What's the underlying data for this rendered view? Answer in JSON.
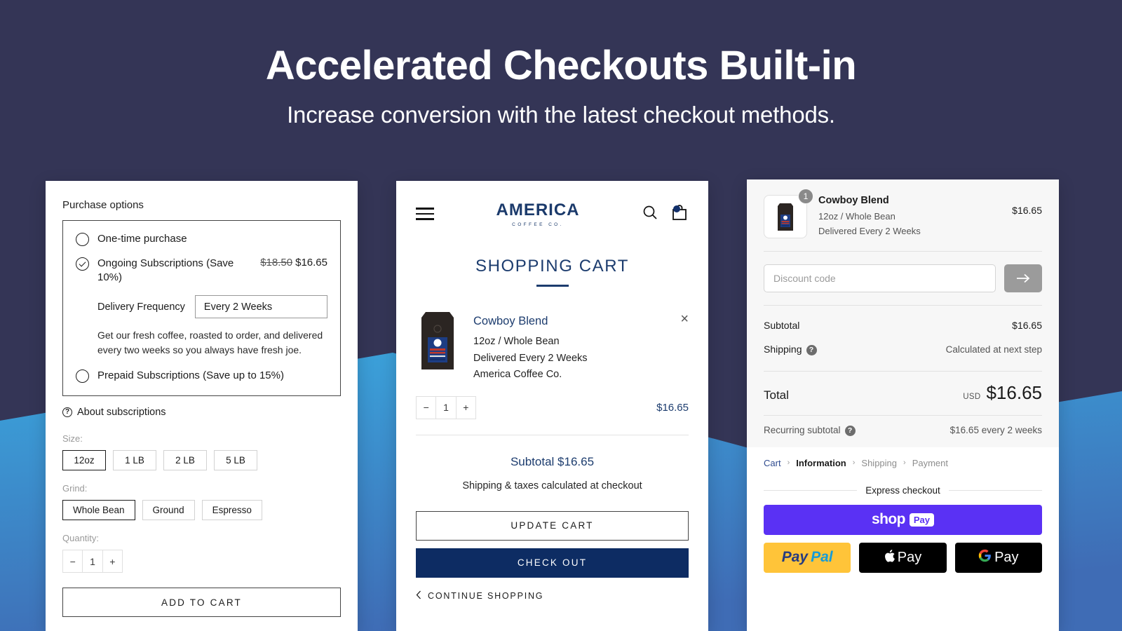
{
  "hero": {
    "title": "Accelerated Checkouts Built-in",
    "subtitle": "Increase conversion with the latest checkout methods."
  },
  "colors": {
    "background_dark": "#343556",
    "wave_blue_light": "#3aa6dd",
    "wave_blue_dark": "#3f6cb5",
    "brand_navy": "#1c3c6e",
    "checkout_button": "#0d2c63",
    "shop_pay_purple": "#5a31f4",
    "paypal_yellow": "#ffc439"
  },
  "product_panel": {
    "purchase_options_label": "Purchase options",
    "options": [
      {
        "label": "One-time purchase",
        "selected": false
      },
      {
        "label": "Ongoing Subscriptions (Save 10%)",
        "selected": true,
        "price_old": "$18.50",
        "price_new": "$16.65"
      },
      {
        "label": "Prepaid Subscriptions (Save up to 15%)",
        "selected": false
      }
    ],
    "delivery_frequency_label": "Delivery Frequency",
    "delivery_frequency_value": "Every 2 Weeks",
    "subscription_description": "Get our fresh coffee, roasted to order, and delivered every two weeks so you always have fresh joe.",
    "about_subscriptions": "About subscriptions",
    "size_label": "Size:",
    "size_options": [
      {
        "label": "12oz",
        "selected": true
      },
      {
        "label": "1 LB",
        "selected": false
      },
      {
        "label": "2 LB",
        "selected": false
      },
      {
        "label": "5 LB",
        "selected": false
      }
    ],
    "grind_label": "Grind:",
    "grind_options": [
      {
        "label": "Whole Bean",
        "selected": true
      },
      {
        "label": "Ground",
        "selected": false
      },
      {
        "label": "Espresso",
        "selected": false
      }
    ],
    "quantity_label": "Quantity:",
    "quantity_minus": "−",
    "quantity_value": "1",
    "quantity_plus": "+",
    "add_to_cart": "ADD TO CART"
  },
  "cart_panel": {
    "logo_main": "AMERICA",
    "logo_sub": "COFFEE CO.",
    "page_title": "SHOPPING CART",
    "item": {
      "name": "Cowboy Blend",
      "variant": "12oz / Whole Bean",
      "delivery": "Delivered Every 2 Weeks",
      "vendor": "America Coffee Co.",
      "price": "$16.65",
      "qty_minus": "−",
      "qty_value": "1",
      "qty_plus": "+",
      "remove": "×"
    },
    "subtotal": "Subtotal $16.65",
    "shipping_note": "Shipping & taxes calculated at checkout",
    "update_cart": "UPDATE CART",
    "check_out": "CHECK OUT",
    "continue_shopping": "CONTINUE SHOPPING"
  },
  "checkout_panel": {
    "item": {
      "name": "Cowboy Blend",
      "variant": "12oz / Whole Bean",
      "delivery": "Delivered Every 2 Weeks",
      "price": "$16.65",
      "quantity_badge": "1"
    },
    "discount_placeholder": "Discount code",
    "discount_apply_icon": "→",
    "subtotal_label": "Subtotal",
    "subtotal_value": "$16.65",
    "shipping_label": "Shipping",
    "shipping_value": "Calculated at next step",
    "total_label": "Total",
    "total_currency": "USD",
    "total_value": "$16.65",
    "recurring_label": "Recurring subtotal",
    "recurring_value": "$16.65 every 2 weeks",
    "breadcrumbs": [
      "Cart",
      "Information",
      "Shipping",
      "Payment"
    ],
    "breadcrumb_separator": "›",
    "express_checkout_label": "Express checkout",
    "shop_pay": {
      "word": "shop",
      "pill": "Pay"
    },
    "paypal": {
      "pay": "Pay",
      "pal": "Pal"
    },
    "apple_pay": {
      "glyph": "",
      "label": "Pay"
    },
    "google_pay": {
      "glyph": "G",
      "label": "Pay"
    }
  }
}
